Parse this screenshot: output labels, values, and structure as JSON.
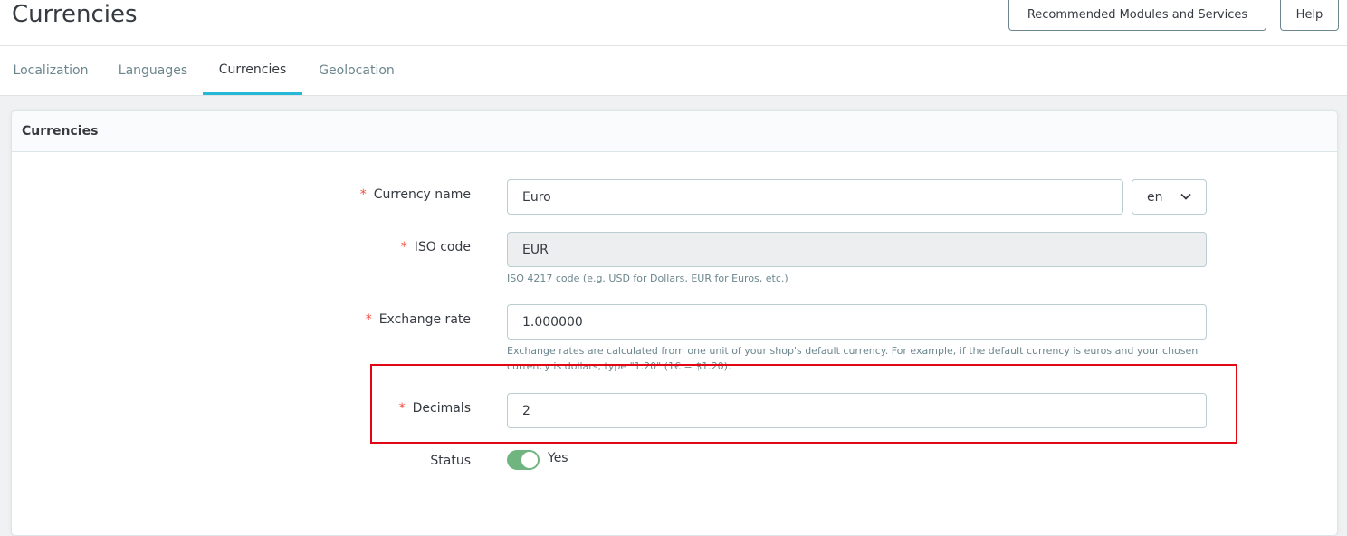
{
  "header": {
    "title": "Currencies",
    "recommended_label": "Recommended Modules and Services",
    "help_label": "Help"
  },
  "tabs": [
    {
      "label": "Localization",
      "active": false
    },
    {
      "label": "Languages",
      "active": false
    },
    {
      "label": "Currencies",
      "active": true
    },
    {
      "label": "Geolocation",
      "active": false
    }
  ],
  "card": {
    "title": "Currencies"
  },
  "form": {
    "required_mark": "*",
    "currency_name": {
      "label": "Currency name",
      "value": "Euro",
      "language": "en"
    },
    "iso_code": {
      "label": "ISO code",
      "value": "EUR",
      "help": "ISO 4217 code (e.g. USD for Dollars, EUR for Euros, etc.)"
    },
    "exchange_rate": {
      "label": "Exchange rate",
      "value": "1.000000",
      "help_line1": "Exchange rates are calculated from one unit of your shop's default currency. For example, if the default currency is euros and your chosen",
      "help_line2": "currency is dollars, type \"1.20\" (1€ = $1.20)."
    },
    "decimals": {
      "label": "Decimals",
      "value": "2"
    },
    "status": {
      "label": "Status",
      "value_label": "Yes",
      "enabled": true
    }
  },
  "colors": {
    "accent": "#25b9d7",
    "required": "#f54c3e",
    "toggle_on": "#70b580",
    "highlight": "#e30613"
  }
}
